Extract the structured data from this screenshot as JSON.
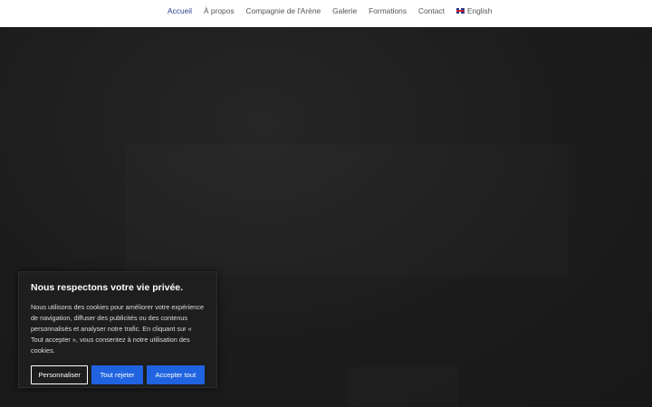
{
  "nav": {
    "items": [
      {
        "label": "Accueil",
        "active": true
      },
      {
        "label": "À propos"
      },
      {
        "label": "Compagnie de l'Arène"
      },
      {
        "label": "Galerie"
      },
      {
        "label": "Formations"
      },
      {
        "label": "Contact"
      }
    ],
    "language": {
      "label": "English",
      "icon": "uk-flag-icon"
    }
  },
  "cookie": {
    "title": "Nous respectons votre vie privée.",
    "body": "Nous utilisons des cookies pour améliorer votre expérience de navigation, diffuser des publicités ou des contenus personnalisés et analyser notre trafic. En cliquant sur « Tout accepter », vous consentez à notre utilisation des cookies.",
    "customize_label": "Personnaliser",
    "reject_label": "Tout rejeter",
    "accept_label": "Accepter tout"
  },
  "colors": {
    "accent": "#1f63e0",
    "active_nav": "#2e3f8f",
    "background": "#1b1b1b"
  }
}
